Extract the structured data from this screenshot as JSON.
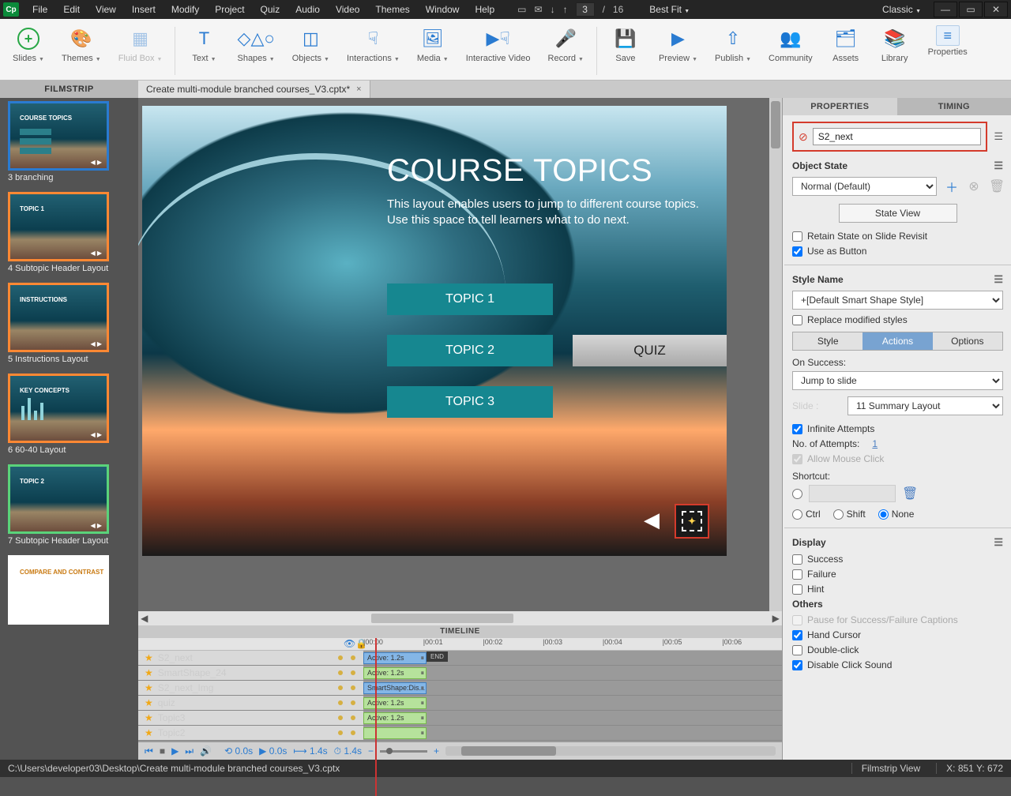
{
  "app": {
    "logo": "Cp",
    "workspace": "Classic"
  },
  "menu": [
    "File",
    "Edit",
    "View",
    "Insert",
    "Modify",
    "Project",
    "Quiz",
    "Audio",
    "Video",
    "Themes",
    "Window",
    "Help"
  ],
  "pager": {
    "current": "3",
    "sep": "/",
    "total": "16"
  },
  "zoom": "Best Fit",
  "ribbon": [
    {
      "label": "Slides",
      "icon": "+",
      "dd": true,
      "add": true
    },
    {
      "label": "Themes",
      "icon": "🎨",
      "dd": true
    },
    {
      "label": "Fluid Box",
      "icon": "▦",
      "dd": true,
      "disabled": true
    },
    {
      "sep": true
    },
    {
      "label": "Text",
      "icon": "T",
      "dd": true
    },
    {
      "label": "Shapes",
      "icon": "◇△○",
      "dd": true
    },
    {
      "label": "Objects",
      "icon": "◫",
      "dd": true
    },
    {
      "label": "Interactions",
      "icon": "☟",
      "dd": true
    },
    {
      "label": "Media",
      "icon": "🖼",
      "dd": true
    },
    {
      "label": "Interactive Video",
      "icon": "▶☟"
    },
    {
      "label": "Record",
      "icon": "🎤",
      "dd": true
    },
    {
      "sep": true
    },
    {
      "label": "Save",
      "icon": "💾"
    },
    {
      "label": "Preview",
      "icon": "▶",
      "dd": true
    },
    {
      "label": "Publish",
      "icon": "⇧",
      "dd": true
    },
    {
      "label": "Community",
      "icon": "👥"
    },
    {
      "label": "Assets",
      "icon": "🗂"
    },
    {
      "label": "Library",
      "icon": "📚"
    },
    {
      "label": "Properties",
      "icon": "≡",
      "last": true
    }
  ],
  "filmstrip_hdr": "FILMSTRIP",
  "doc_tab": "Create multi-module branched courses_V3.cptx*",
  "slides": [
    {
      "name": "3 branching",
      "border": "blue",
      "title": "COURSE TOPICS",
      "rows": 3
    },
    {
      "name": "4 Subtopic Header Layout",
      "border": "orange",
      "title": "TOPIC 1"
    },
    {
      "name": "5 Instructions Layout",
      "border": "orange",
      "title": "INSTRUCTIONS"
    },
    {
      "name": "6 60-40 Layout",
      "border": "orange",
      "title": "KEY CONCEPTS",
      "bars": true
    },
    {
      "name": "7 Subtopic Header Layout",
      "border": "green",
      "title": "TOPIC 2"
    },
    {
      "name": "",
      "border": "green",
      "title": "COMPARE AND CONTRAST",
      "white": true
    }
  ],
  "stage": {
    "heading": "COURSE TOPICS",
    "body": "This layout enables users to jump to different course topics. Use this space to tell learners what to do next.",
    "topic1": "TOPIC 1",
    "topic2": "TOPIC 2",
    "topic3": "TOPIC 3",
    "quiz": "QUIZ"
  },
  "timeline": {
    "hdr": "TIMELINE",
    "ticks": [
      "|00:00",
      "|00:01",
      "|00:02",
      "|00:03",
      "|00:04",
      "|00:05",
      "|00:06"
    ],
    "tracks": [
      {
        "name": "S2_next",
        "clip": "Active: 1.2s",
        "sel": true,
        "end": "END"
      },
      {
        "name": "SmartShape_24",
        "clip": "Active: 1.2s"
      },
      {
        "name": "S2_next_Img",
        "clip": "SmartShape:Dis...",
        "sel": true
      },
      {
        "name": "quiz",
        "clip": "Active: 1.2s"
      },
      {
        "name": "Topic3",
        "clip": "Active: 1.2s"
      },
      {
        "name": "Topic2",
        "clip": ""
      }
    ],
    "foot": {
      "t1": "0.0s",
      "t2": "0.0s",
      "t3": "1.4s",
      "t4": "1.4s"
    }
  },
  "props": {
    "tabs": [
      "PROPERTIES",
      "TIMING"
    ],
    "name": "S2_next",
    "objstate_hdr": "Object State",
    "objstate": "Normal (Default)",
    "stateview": "State View",
    "retain": "Retain State on Slide Revisit",
    "usebtn": "Use as Button",
    "stylename_hdr": "Style Name",
    "stylename": "+[Default Smart Shape Style]",
    "replace": "Replace modified styles",
    "subtabs": [
      "Style",
      "Actions",
      "Options"
    ],
    "onsuccess": "On Success:",
    "onsuccess_val": "Jump to slide",
    "slide_lbl": "Slide :",
    "slide_val": "11 Summary Layout",
    "infinite": "Infinite Attempts",
    "attempts_lbl": "No. of Attempts:",
    "attempts_val": "1",
    "allowmouse": "Allow Mouse Click",
    "shortcut": "Shortcut:",
    "radios": [
      "Ctrl",
      "Shift",
      "None"
    ],
    "display_hdr": "Display",
    "display": [
      "Success",
      "Failure",
      "Hint"
    ],
    "others_hdr": "Others",
    "pause": "Pause for Success/Failure Captions",
    "hand": "Hand Cursor",
    "dbl": "Double-click",
    "dcs": "Disable Click Sound"
  },
  "status": {
    "path": "C:\\Users\\developer03\\Desktop\\Create multi-module branched courses_V3.cptx",
    "mode": "Filmstrip View",
    "coord": "X: 851 Y: 672"
  }
}
